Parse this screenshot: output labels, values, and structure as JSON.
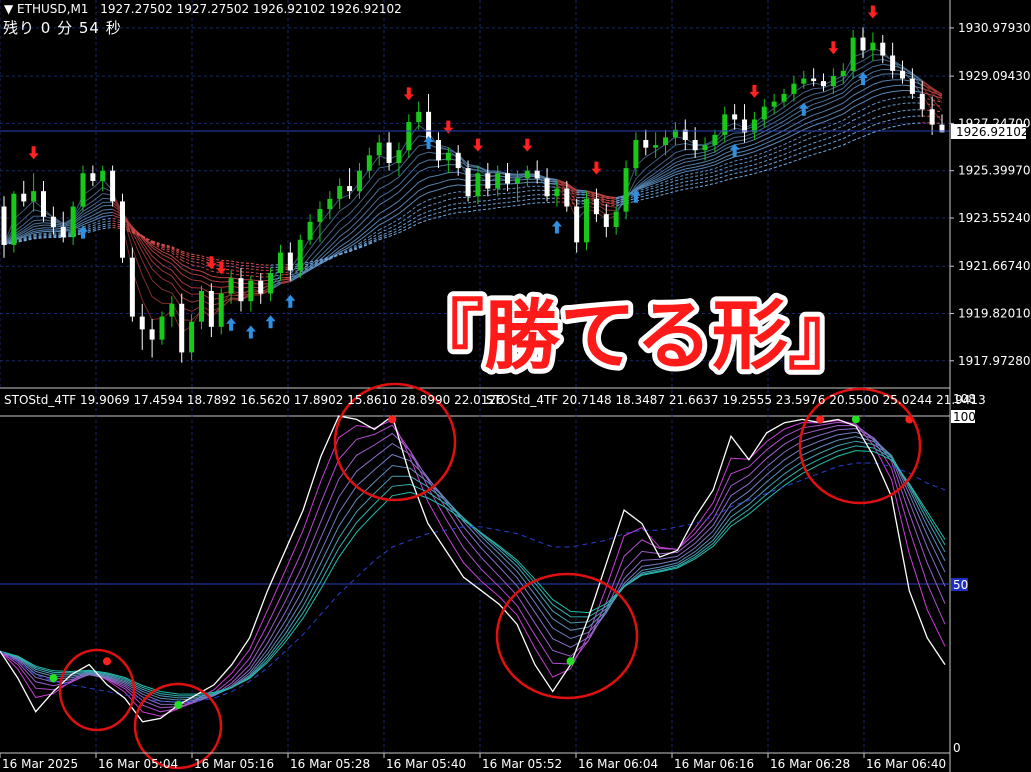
{
  "header": {
    "symbol": "ETHUSD,M1",
    "ohlc": "1927.27502 1927.27502 1926.92102 1926.92102",
    "countdown": "残り 0 分 54 秒"
  },
  "banner": "『勝てる形』",
  "indicator": {
    "label_1": "STOStd_4TF 19.9069 17.4594 18.7892 16.5620 17.8902 15.8610 28.8990 22.0126",
    "label_2": "STOStd_4TF 20.7148 18.3487 21.6637 19.2555 23.5976 20.5500 25.0244 21.9413"
  },
  "colors": {
    "bull": "#19c919",
    "bear": "#ffffff",
    "up_arrow": "#2f8fe0",
    "down_arrow": "#ff2020",
    "grid": "#1a2a66",
    "circle": "#e01010"
  },
  "chart_data": [
    {
      "type": "candlestick",
      "title": "",
      "y_ticks": [
        "1930.97930",
        "1929.09430",
        "1927.24700",
        "1925.39970",
        "1923.55240",
        "1921.66740",
        "1919.82010",
        "1917.97280"
      ],
      "ylim": [
        1917.3,
        1931.6
      ],
      "current_price": "1926.92102",
      "grid": true,
      "candles": [
        [
          1924.0,
          1924.4,
          1922.0,
          1922.5
        ],
        [
          1922.5,
          1924.6,
          1922.2,
          1924.5
        ],
        [
          1924.5,
          1925.0,
          1924.0,
          1924.2
        ],
        [
          1924.2,
          1925.3,
          1923.8,
          1924.6
        ],
        [
          1924.6,
          1925.0,
          1923.4,
          1923.6
        ],
        [
          1923.6,
          1924.0,
          1922.9,
          1923.2
        ],
        [
          1923.2,
          1923.8,
          1922.6,
          1922.8
        ],
        [
          1922.8,
          1924.2,
          1922.5,
          1924.0
        ],
        [
          1924.0,
          1925.6,
          1923.8,
          1925.3
        ],
        [
          1925.3,
          1925.6,
          1924.8,
          1925.0
        ],
        [
          1925.0,
          1925.6,
          1924.6,
          1925.4
        ],
        [
          1925.4,
          1925.6,
          1924.0,
          1924.2
        ],
        [
          1924.2,
          1924.5,
          1921.8,
          1922.0
        ],
        [
          1922.0,
          1922.4,
          1919.5,
          1919.7
        ],
        [
          1919.7,
          1920.2,
          1918.4,
          1919.2
        ],
        [
          1919.2,
          1919.6,
          1918.1,
          1918.8
        ],
        [
          1918.8,
          1919.9,
          1918.6,
          1919.7
        ],
        [
          1919.7,
          1920.5,
          1919.3,
          1920.2
        ],
        [
          1920.2,
          1920.6,
          1917.9,
          1918.3
        ],
        [
          1918.3,
          1919.8,
          1918.0,
          1919.5
        ],
        [
          1919.5,
          1920.9,
          1919.2,
          1920.7
        ],
        [
          1920.7,
          1921.0,
          1918.9,
          1919.3
        ],
        [
          1919.3,
          1920.8,
          1919.0,
          1920.6
        ],
        [
          1920.6,
          1921.5,
          1920.2,
          1921.2
        ],
        [
          1921.2,
          1921.6,
          1919.9,
          1920.3
        ],
        [
          1920.3,
          1921.3,
          1919.9,
          1921.1
        ],
        [
          1921.1,
          1921.4,
          1920.2,
          1920.6
        ],
        [
          1920.6,
          1921.6,
          1920.3,
          1921.4
        ],
        [
          1921.4,
          1922.5,
          1921.1,
          1922.2
        ],
        [
          1922.2,
          1922.6,
          1921.1,
          1921.5
        ],
        [
          1921.5,
          1922.9,
          1921.2,
          1922.7
        ],
        [
          1922.7,
          1923.7,
          1922.5,
          1923.4
        ],
        [
          1923.4,
          1924.2,
          1922.6,
          1923.9
        ],
        [
          1923.9,
          1924.6,
          1923.5,
          1924.3
        ],
        [
          1924.3,
          1925.1,
          1923.9,
          1924.8
        ],
        [
          1924.8,
          1925.5,
          1924.3,
          1924.6
        ],
        [
          1924.6,
          1925.7,
          1924.3,
          1925.4
        ],
        [
          1925.4,
          1926.3,
          1925.1,
          1926.0
        ],
        [
          1926.0,
          1926.8,
          1925.6,
          1926.5
        ],
        [
          1926.5,
          1926.9,
          1925.4,
          1925.7
        ],
        [
          1925.7,
          1926.5,
          1925.2,
          1926.2
        ],
        [
          1926.2,
          1927.6,
          1925.9,
          1927.3
        ],
        [
          1927.3,
          1928.1,
          1927.0,
          1927.7
        ],
        [
          1927.7,
          1928.4,
          1927.3,
          1926.6
        ],
        [
          1926.6,
          1926.9,
          1925.5,
          1925.8
        ],
        [
          1925.8,
          1926.3,
          1925.3,
          1926.1
        ],
        [
          1926.1,
          1926.4,
          1925.2,
          1925.5
        ],
        [
          1925.5,
          1925.8,
          1924.2,
          1924.4
        ],
        [
          1924.4,
          1925.6,
          1924.1,
          1925.3
        ],
        [
          1925.3,
          1925.7,
          1924.4,
          1924.7
        ],
        [
          1924.7,
          1925.6,
          1924.4,
          1925.3
        ],
        [
          1925.3,
          1925.7,
          1924.6,
          1924.9
        ],
        [
          1924.9,
          1925.4,
          1924.2,
          1925.1
        ],
        [
          1925.1,
          1925.6,
          1924.8,
          1925.4
        ],
        [
          1925.4,
          1925.8,
          1924.9,
          1925.1
        ],
        [
          1925.1,
          1925.5,
          1924.2,
          1924.4
        ],
        [
          1924.4,
          1925.0,
          1924.0,
          1924.7
        ],
        [
          1924.7,
          1925.0,
          1923.8,
          1924.0
        ],
        [
          1924.0,
          1924.3,
          1922.2,
          1922.6
        ],
        [
          1922.6,
          1924.6,
          1922.3,
          1924.3
        ],
        [
          1924.3,
          1924.7,
          1923.4,
          1923.7
        ],
        [
          1923.7,
          1924.1,
          1922.8,
          1923.2
        ],
        [
          1923.2,
          1924.0,
          1922.9,
          1923.8
        ],
        [
          1923.8,
          1925.8,
          1923.5,
          1925.5
        ],
        [
          1925.5,
          1926.9,
          1925.2,
          1926.6
        ],
        [
          1926.6,
          1927.0,
          1926.0,
          1926.3
        ],
        [
          1926.3,
          1926.9,
          1925.9,
          1926.4
        ],
        [
          1926.4,
          1927.0,
          1926.0,
          1926.7
        ],
        [
          1926.7,
          1927.3,
          1926.4,
          1927.0
        ],
        [
          1927.0,
          1927.4,
          1926.2,
          1926.6
        ],
        [
          1926.6,
          1927.1,
          1925.9,
          1926.2
        ],
        [
          1926.2,
          1926.7,
          1925.8,
          1926.4
        ],
        [
          1926.4,
          1927.0,
          1926.1,
          1926.8
        ],
        [
          1926.8,
          1927.9,
          1926.5,
          1927.6
        ],
        [
          1927.6,
          1928.0,
          1927.0,
          1927.4
        ],
        [
          1927.4,
          1928.0,
          1926.5,
          1926.9
        ],
        [
          1926.9,
          1927.7,
          1926.6,
          1927.4
        ],
        [
          1927.4,
          1928.2,
          1927.1,
          1927.9
        ],
        [
          1927.9,
          1928.4,
          1927.6,
          1928.1
        ],
        [
          1928.1,
          1928.6,
          1927.9,
          1928.4
        ],
        [
          1928.4,
          1929.1,
          1928.1,
          1928.8
        ],
        [
          1928.8,
          1929.3,
          1928.6,
          1929.0
        ],
        [
          1929.0,
          1929.4,
          1928.7,
          1928.9
        ],
        [
          1928.9,
          1929.2,
          1928.5,
          1928.7
        ],
        [
          1928.7,
          1929.4,
          1928.4,
          1929.1
        ],
        [
          1929.1,
          1929.6,
          1928.8,
          1929.3
        ],
        [
          1929.3,
          1930.9,
          1929.0,
          1930.6
        ],
        [
          1930.6,
          1931.0,
          1929.8,
          1930.1
        ],
        [
          1930.1,
          1930.8,
          1929.7,
          1930.4
        ],
        [
          1930.4,
          1930.7,
          1929.6,
          1929.9
        ],
        [
          1929.9,
          1930.4,
          1929.0,
          1929.3
        ],
        [
          1929.3,
          1929.7,
          1928.8,
          1929.0
        ],
        [
          1929.0,
          1929.4,
          1928.2,
          1928.4
        ],
        [
          1928.4,
          1928.9,
          1927.5,
          1927.8
        ],
        [
          1927.8,
          1928.3,
          1926.8,
          1927.2
        ],
        [
          1927.2,
          1927.6,
          1926.9,
          1926.9
        ]
      ],
      "buy_arrows": [
        8,
        23,
        25,
        27,
        29,
        43,
        56,
        64,
        74,
        81,
        87
      ],
      "sell_arrows": [
        3,
        21,
        22,
        41,
        45,
        48,
        53,
        60,
        76,
        84,
        88
      ]
    },
    {
      "type": "line",
      "title": "",
      "y_ticks": [
        "108",
        "100",
        "50",
        "0"
      ],
      "ylim": [
        0,
        108
      ],
      "x_ticks": [
        "16 Mar 2025",
        "16 Mar 05:04",
        "16 Mar 05:16",
        "16 Mar 05:28",
        "16 Mar 05:40",
        "16 Mar 05:52",
        "16 Mar 06:04",
        "16 Mar 06:16",
        "16 Mar 06:28",
        "16 Mar 06:40"
      ],
      "main_stoch": [
        30,
        22,
        12,
        18,
        23,
        26,
        20,
        16,
        9,
        10,
        14,
        17,
        20,
        26,
        34,
        48,
        60,
        72,
        88,
        100,
        99,
        96,
        100,
        82,
        68,
        60,
        52,
        48,
        44,
        38,
        26,
        18,
        26,
        40,
        56,
        72,
        68,
        58,
        60,
        70,
        78,
        94,
        87,
        95,
        98,
        99,
        98,
        99,
        97,
        88,
        76,
        48,
        34,
        26
      ],
      "baseline": [
        30,
        27,
        23,
        21,
        20,
        19,
        18,
        17,
        16,
        15,
        15,
        15,
        16,
        18,
        21,
        25,
        30,
        35,
        41,
        47,
        52,
        57,
        61,
        63,
        65,
        66,
        67,
        67,
        66,
        65,
        63,
        61,
        61,
        62,
        63,
        65,
        66,
        66,
        67,
        68,
        70,
        73,
        75,
        77,
        79,
        81,
        83,
        85,
        86,
        86,
        85,
        83,
        80,
        78
      ],
      "buy_signals": [
        [
          3,
          22
        ],
        [
          10,
          14
        ],
        [
          32,
          27
        ],
        [
          48,
          99
        ]
      ],
      "sell_signals": [
        [
          6,
          27
        ],
        [
          22,
          99
        ],
        [
          46,
          99
        ],
        [
          51,
          99
        ]
      ]
    }
  ]
}
